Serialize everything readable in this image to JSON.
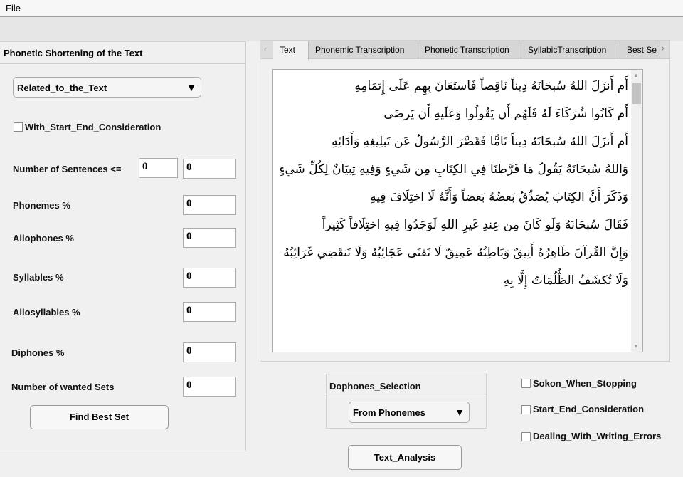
{
  "menu": {
    "file": "File"
  },
  "left_panel": {
    "title": "Phonetic Shortening of the Text",
    "mode_dropdown": "Related_to_the_Text",
    "with_start_end": {
      "label": "With_Start_End_Consideration",
      "checked": false
    },
    "sentences": {
      "label": "Number of Sentences <=",
      "value1": "0",
      "value2": "0"
    },
    "phonemes": {
      "label": "Phonemes %",
      "value": "0"
    },
    "allophones": {
      "label": "Allophones %",
      "value": "0"
    },
    "syllables": {
      "label": "Syllables %",
      "value": "0"
    },
    "allosyllables": {
      "label": "Allosyllables %",
      "value": "0"
    },
    "diphones": {
      "label": "Diphones %",
      "value": "0"
    },
    "wanted_sets": {
      "label": "Number of wanted Sets",
      "value": "0"
    },
    "find_button": "Find Best Set"
  },
  "tabs": [
    {
      "label": "Text",
      "active": true
    },
    {
      "label": "Phonemic Transcription"
    },
    {
      "label": "Phonetic Transcription"
    },
    {
      "label": "SyllabicTranscription"
    },
    {
      "label": "Best Se"
    }
  ],
  "text_lines": [
    "أَم أَنزَلَ اللهُ سُبحَانَهُ دِيناً نَاقِصاً فَاستَعَانَ بِهِم عَلَى إِتمَامِهِ",
    "أَم كَانُوا شُرَكَاءَ لَهُ فَلَهُم أَن يَقُولُوا وَعَلَيهِ أَن يَرضَى",
    "أَم أَنزَلَ اللهُ سُبحَانَهُ دِيناً تَامًّا فَقَصَّرَ الرَّسُولُ عَن تَبلِيغِهِ وَأَدَائِهِ",
    "وَاللهُ سُبحَانَهُ يَقُولُ مَا فَرَّطنَا فِي الكِتَابِ مِن شَيءٍ وَفِيهِ تِبيَانٌ لِكُلِّ شَيءٍ",
    "وَذَكَرَ أَنَّ الكِتَابَ يُصَدِّقُ بَعضُهُ بَعضاً وَأَنَّهُ لَا اختِلَافَ فِيهِ",
    "فَقَالَ سُبحَانَهُ وَلَو كَانَ مِن عِندِ غَيرِ اللهِ لَوَجَدُوا فِيهِ اختِلَافاً كَثِيراً",
    "وَإِنَّ القُرآنَ ظَاهِرُهُ أَنِيقٌ وَبَاطِنُهُ عَمِيقٌ لَا تَفنَى عَجَائِبُهُ وَلَا تَنقَضِي غَرَائِبُهُ",
    "وَلَا تُكشَفُ الظُّلُمَاتُ إِلَّا بِهِ"
  ],
  "diphones_panel": {
    "title": "Dophones_Selection",
    "dropdown": "From Phonemes"
  },
  "options": [
    {
      "label": "Sokon_When_Stopping",
      "checked": false
    },
    {
      "label": "Start_End_Consideration",
      "checked": false
    },
    {
      "label": "Dealing_With_Writing_Errors",
      "checked": false
    }
  ],
  "analysis_button": "Text_Analysis"
}
